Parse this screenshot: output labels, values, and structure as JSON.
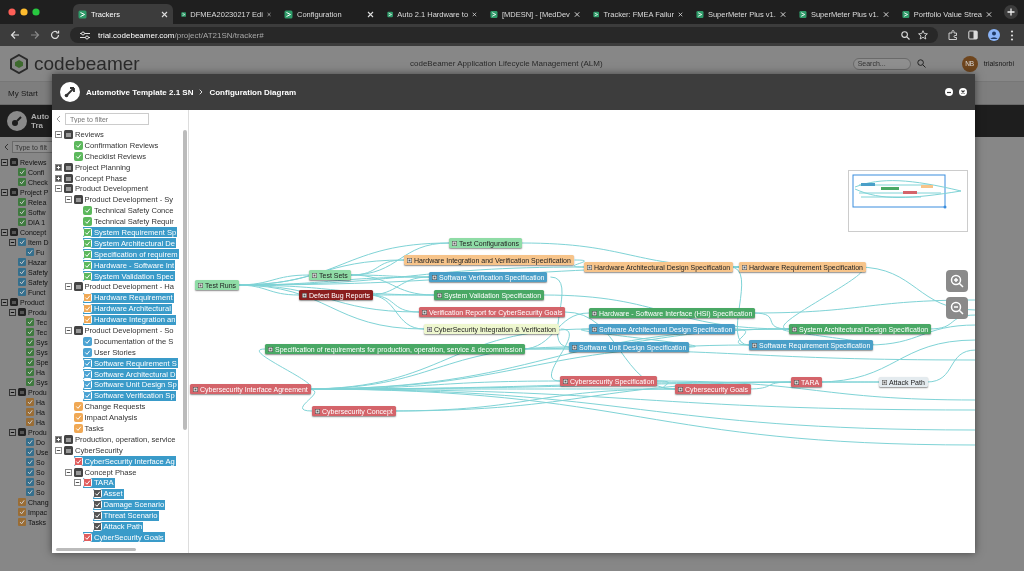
{
  "browser": {
    "tabs": [
      {
        "title": "Trackers",
        "selected": true
      },
      {
        "title": "DFMEA20230217 Edi",
        "selected": false
      },
      {
        "title": "Configuration",
        "selected": false
      },
      {
        "title": "Auto 2.1 Hardware to",
        "selected": false
      },
      {
        "title": "[MDESN] - [MedDev",
        "selected": false
      },
      {
        "title": "Tracker: FMEA Failur",
        "selected": false
      },
      {
        "title": "SuperMeter Plus v1.",
        "selected": false
      },
      {
        "title": "SuperMeter Plus v1.",
        "selected": false
      },
      {
        "title": "Portfolio Value Strea",
        "selected": false
      }
    ],
    "address": {
      "host": "trial.codebeamer.com",
      "path": "/project/AT21SN/tracker#"
    }
  },
  "app": {
    "logo": "codebeamer",
    "title": "codeBeamer Application Lifecycle Management (ALM)",
    "search": {
      "placeholder": "Search..."
    },
    "user": {
      "initials": "NB",
      "name": "trialsnorbi"
    },
    "nav": [
      "My Start"
    ],
    "project": [
      "Auto",
      "Tra"
    ],
    "sidebar": {
      "filter": {
        "placeholder": "Type to filt"
      },
      "tree": [
        {
          "label": "Reviews",
          "kind": "folder",
          "expanded": true,
          "children": [
            {
              "label": "Confi",
              "kind": "tracker",
              "color": "#3f7a3f"
            },
            {
              "label": "Check",
              "kind": "tracker",
              "color": "#3f7a3f"
            }
          ]
        },
        {
          "label": "Project P",
          "kind": "folder",
          "expanded": true,
          "children": [
            {
              "label": "Relea",
              "kind": "tracker",
              "color": "#3f7a3f"
            },
            {
              "label": "Softw",
              "kind": "tracker",
              "color": "#3f7a3f"
            },
            {
              "label": "DIA 1",
              "kind": "tracker",
              "color": "#3f7a3f"
            }
          ]
        },
        {
          "label": "Concept",
          "kind": "folder",
          "expanded": true,
          "children": [
            {
              "label": "Item D",
              "kind": "tracker",
              "color": "#356f8d",
              "expanded": true,
              "children": [
                {
                  "label": "Fu",
                  "kind": "tracker",
                  "color": "#356f8d"
                }
              ]
            },
            {
              "label": "Hazar",
              "kind": "tracker",
              "color": "#356f8d"
            },
            {
              "label": "Safety",
              "kind": "tracker",
              "color": "#356f8d"
            },
            {
              "label": "Safety",
              "kind": "tracker",
              "color": "#356f8d"
            },
            {
              "label": "Funct",
              "kind": "tracker",
              "color": "#356f8d"
            }
          ]
        },
        {
          "label": "Product",
          "kind": "folder",
          "expanded": true,
          "children": [
            {
              "label": "Produ",
              "kind": "folder",
              "expanded": true,
              "children": [
                {
                  "label": "Tec",
                  "kind": "tracker",
                  "color": "#3f7a3f"
                },
                {
                  "label": "Tec",
                  "kind": "tracker",
                  "color": "#3f7a3f"
                },
                {
                  "label": "Sys",
                  "kind": "tracker",
                  "color": "#3f7a3f"
                },
                {
                  "label": "Sys",
                  "kind": "tracker",
                  "color": "#3f7a3f"
                },
                {
                  "label": "Spe",
                  "kind": "tracker",
                  "color": "#3f7a3f"
                },
                {
                  "label": "Ha",
                  "kind": "tracker",
                  "color": "#3f7a3f"
                },
                {
                  "label": "Sys",
                  "kind": "tracker",
                  "color": "#3f7a3f"
                }
              ]
            },
            {
              "label": "Produ",
              "kind": "folder",
              "expanded": true,
              "children": [
                {
                  "label": "Ha",
                  "kind": "tracker",
                  "color": "#9a6d35"
                },
                {
                  "label": "Ha",
                  "kind": "tracker",
                  "color": "#9a6d35"
                },
                {
                  "label": "Ha",
                  "kind": "tracker",
                  "color": "#9a6d35"
                }
              ]
            },
            {
              "label": "Produ",
              "kind": "folder",
              "expanded": true,
              "children": [
                {
                  "label": "Do",
                  "kind": "tracker",
                  "color": "#356f8d"
                },
                {
                  "label": "Use",
                  "kind": "tracker",
                  "color": "#356f8d"
                },
                {
                  "label": "So",
                  "kind": "tracker",
                  "color": "#356f8d"
                },
                {
                  "label": "So",
                  "kind": "tracker",
                  "color": "#356f8d"
                },
                {
                  "label": "So",
                  "kind": "tracker",
                  "color": "#356f8d"
                },
                {
                  "label": "So",
                  "kind": "tracker",
                  "color": "#356f8d"
                }
              ]
            },
            {
              "label": "Chang",
              "kind": "tracker",
              "color": "#9a6d35"
            },
            {
              "label": "Impac",
              "kind": "tracker",
              "color": "#9a6d35"
            },
            {
              "label": "Tasks",
              "kind": "tracker",
              "color": "#9a6d35"
            }
          ]
        }
      ]
    }
  },
  "dialog": {
    "breadcrumb": [
      "Automotive Template 2.1 SN",
      "Configuration Diagram"
    ],
    "filter": {
      "placeholder": "Type to filter"
    },
    "tree": [
      {
        "label": "Reviews",
        "kind": "folder",
        "selected": false,
        "expanded": true,
        "children": [
          {
            "label": "Confirmation Reviews",
            "kind": "tracker",
            "color": "#5cb85c",
            "selected": false
          },
          {
            "label": "Checklist Reviews",
            "kind": "tracker",
            "color": "#5cb85c",
            "selected": false
          }
        ]
      },
      {
        "label": "Project Planning",
        "kind": "folder",
        "selected": false,
        "expanded": false
      },
      {
        "label": "Concept Phase",
        "kind": "folder",
        "selected": false,
        "expanded": false
      },
      {
        "label": "Product Development",
        "kind": "folder",
        "selected": false,
        "expanded": true,
        "children": [
          {
            "label": "Product Development - Sy",
            "kind": "folder",
            "selected": false,
            "expanded": true,
            "children": [
              {
                "label": "Technical Safety Conce",
                "kind": "tracker",
                "color": "#5cb85c",
                "selected": false
              },
              {
                "label": "Technical Safety Requir",
                "kind": "tracker",
                "color": "#5cb85c",
                "selected": false
              },
              {
                "label": "System Requirement Sp",
                "kind": "tracker",
                "color": "#5cb85c",
                "selected": true
              },
              {
                "label": "System Architectural De",
                "kind": "tracker",
                "color": "#5cb85c",
                "selected": true
              },
              {
                "label": "Specification of requirem",
                "kind": "tracker",
                "color": "#5cb85c",
                "selected": true
              },
              {
                "label": "Hardware - Software Int",
                "kind": "tracker",
                "color": "#5cb85c",
                "selected": true
              },
              {
                "label": "System Validation Spec",
                "kind": "tracker",
                "color": "#5cb85c",
                "selected": true
              }
            ]
          },
          {
            "label": "Product Development - Ha",
            "kind": "folder",
            "selected": false,
            "expanded": true,
            "children": [
              {
                "label": "Hardware Requirement",
                "kind": "tracker",
                "color": "#f0a854",
                "selected": true
              },
              {
                "label": "Hardware Architectural",
                "kind": "tracker",
                "color": "#f0a854",
                "selected": true
              },
              {
                "label": "Hardware Integration an",
                "kind": "tracker",
                "color": "#f0a854",
                "selected": true
              }
            ]
          },
          {
            "label": "Product Development - So",
            "kind": "folder",
            "selected": false,
            "expanded": true,
            "children": [
              {
                "label": "Documentation of the S",
                "kind": "tracker",
                "color": "#4ba3d3",
                "selected": false
              },
              {
                "label": "User Stories",
                "kind": "tracker",
                "color": "#4ba3d3",
                "selected": false
              },
              {
                "label": "Software Requirement S",
                "kind": "tracker",
                "color": "#4ba3d3",
                "selected": true
              },
              {
                "label": "Software Architectural D",
                "kind": "tracker",
                "color": "#4ba3d3",
                "selected": true
              },
              {
                "label": "Software Unit Design Sp",
                "kind": "tracker",
                "color": "#4ba3d3",
                "selected": true
              },
              {
                "label": "Software Verification Sp",
                "kind": "tracker",
                "color": "#4ba3d3",
                "selected": true
              }
            ]
          },
          {
            "label": "Change Requests",
            "kind": "tracker",
            "color": "#f0a854",
            "selected": false
          },
          {
            "label": "Impact Analysis",
            "kind": "tracker",
            "color": "#f0a854",
            "selected": false
          },
          {
            "label": "Tasks",
            "kind": "tracker",
            "color": "#f0a854",
            "selected": false
          }
        ]
      },
      {
        "label": "Production, operation, service",
        "kind": "folder",
        "selected": false,
        "expanded": false
      },
      {
        "label": "CyberSecurity",
        "kind": "folder",
        "selected": false,
        "expanded": true,
        "children": [
          {
            "label": "CyberSecurity Interface Ag",
            "kind": "tracker",
            "color": "#e05d5d",
            "selected": true
          },
          {
            "label": "Concept Phase",
            "kind": "folder",
            "selected": false,
            "expanded": true,
            "children": [
              {
                "label": "TARA",
                "kind": "tracker",
                "color": "#e05d5d",
                "selected": true,
                "expanded": true,
                "children": [
                  {
                    "label": "Asset",
                    "kind": "tracker",
                    "color": "#555555",
                    "selected": true
                  },
                  {
                    "label": "Damage Scenario",
                    "kind": "tracker",
                    "color": "#555555",
                    "selected": true
                  },
                  {
                    "label": "Threat Scenario",
                    "kind": "tracker",
                    "color": "#555555",
                    "selected": true
                  },
                  {
                    "label": "Attack Path",
                    "kind": "tracker",
                    "color": "#555555",
                    "selected": true
                  }
                ]
              },
              {
                "label": "CyberSecurity Goals",
                "kind": "tracker",
                "color": "#e05d5d",
                "selected": true
              }
            ]
          }
        ]
      }
    ],
    "diagram": {
      "nodes": [
        {
          "label": "Test Runs",
          "color": "#8fdca6"
        },
        {
          "label": "Test Sets",
          "color": "#8fdca6"
        },
        {
          "label": "Defect Bug Reports",
          "color": "#8b1e1e"
        },
        {
          "label": "Test Configurations",
          "color": "#8fdca6"
        },
        {
          "label": "Hardware Integration and Verification Specification",
          "color": "#f7c48a"
        },
        {
          "label": "Software Verification Specification",
          "color": "#4a9fc8"
        },
        {
          "label": "System Validation Specification",
          "color": "#49a865"
        },
        {
          "label": "Verification Report for CyberSecurity Goals",
          "color": "#d4646a"
        },
        {
          "label": "CyberSecurity Integration & Verification",
          "color": "#eef7cf"
        },
        {
          "label": "Specification of requirements for production, operation, service & decommission",
          "color": "#49a865"
        },
        {
          "label": "Cybersecurity Interface Agreement",
          "color": "#d4646a"
        },
        {
          "label": "Cybersecurity Concept",
          "color": "#d4646a"
        },
        {
          "label": "Hardware Architectural Design Specification",
          "color": "#f7c48a"
        },
        {
          "label": "Hardware Requirement Specification",
          "color": "#f7c48a"
        },
        {
          "label": "Hardware - Software Interface (HSI) Specification",
          "color": "#49a865"
        },
        {
          "label": "Software Unit Design Specification",
          "color": "#4a9fc8"
        },
        {
          "label": "Software Architectural Design Specification",
          "color": "#4a9fc8"
        },
        {
          "label": "Software Requirement Specification",
          "color": "#4a9fc8"
        },
        {
          "label": "System Architectural Design Specification",
          "color": "#49a865"
        },
        {
          "label": "Cybersecurity Specification",
          "color": "#d4646a"
        },
        {
          "label": "Cybersecurity Goals",
          "color": "#d4646a"
        },
        {
          "label": "TARA",
          "color": "#d4646a"
        },
        {
          "label": "Attack Path",
          "color": "#e4ebef"
        }
      ]
    }
  }
}
